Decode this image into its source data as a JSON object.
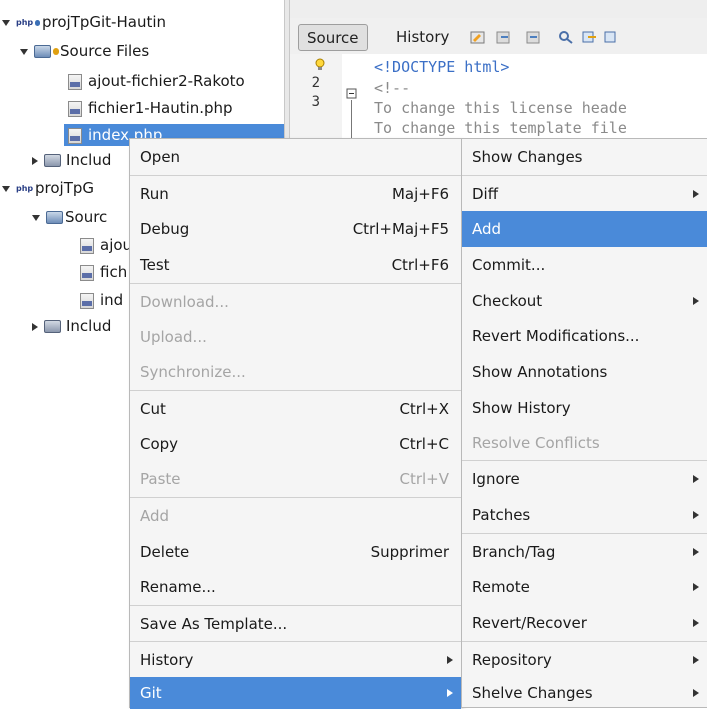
{
  "tree": {
    "project1": {
      "label": "projTpGit-Hautin"
    },
    "source_files1": {
      "label": "Source Files"
    },
    "files1": [
      "ajout-fichier2-Rakoto",
      "fichier1-Hautin.php",
      "index.php"
    ],
    "include1": {
      "label": "Includ"
    },
    "project2": {
      "label": "projTpG"
    },
    "source_files2": {
      "label": "Sourc"
    },
    "files2": [
      "ajou",
      "fich",
      "ind"
    ],
    "include2": {
      "label": "Includ"
    }
  },
  "editor": {
    "tabs": {
      "source": "Source",
      "history": "History"
    },
    "line_numbers": [
      "2",
      "3"
    ],
    "code": [
      "<!DOCTYPE html>",
      "<!--",
      "To change this license heade",
      "To change this template file"
    ]
  },
  "context_menu": {
    "items": [
      {
        "label": "Open",
        "shortcut": "",
        "disabled": false
      },
      {
        "label": "Run",
        "shortcut": "Maj+F6",
        "disabled": false
      },
      {
        "label": "Debug",
        "shortcut": "Ctrl+Maj+F5",
        "disabled": false
      },
      {
        "label": "Test",
        "shortcut": "Ctrl+F6",
        "disabled": false
      },
      {
        "label": "Download...",
        "shortcut": "",
        "disabled": true
      },
      {
        "label": "Upload...",
        "shortcut": "",
        "disabled": true
      },
      {
        "label": "Synchronize...",
        "shortcut": "",
        "disabled": true
      },
      {
        "label": "Cut",
        "shortcut": "Ctrl+X",
        "disabled": false
      },
      {
        "label": "Copy",
        "shortcut": "Ctrl+C",
        "disabled": false
      },
      {
        "label": "Paste",
        "shortcut": "Ctrl+V",
        "disabled": true
      },
      {
        "label": "Add",
        "shortcut": "",
        "disabled": true
      },
      {
        "label": "Delete",
        "shortcut": "Supprimer",
        "disabled": false
      },
      {
        "label": "Rename...",
        "shortcut": "",
        "disabled": false
      },
      {
        "label": "Save As Template...",
        "shortcut": "",
        "disabled": false
      },
      {
        "label": "History",
        "shortcut": "",
        "disabled": false
      },
      {
        "label": "Git",
        "shortcut": "",
        "disabled": false
      }
    ]
  },
  "git_submenu": {
    "items": [
      {
        "label": "Show Changes"
      },
      {
        "label": "Diff"
      },
      {
        "label": "Add"
      },
      {
        "label": "Commit..."
      },
      {
        "label": "Checkout"
      },
      {
        "label": "Revert Modifications..."
      },
      {
        "label": "Show Annotations"
      },
      {
        "label": "Show History"
      },
      {
        "label": "Resolve Conflicts"
      },
      {
        "label": "Ignore"
      },
      {
        "label": "Patches"
      },
      {
        "label": "Branch/Tag"
      },
      {
        "label": "Remote"
      },
      {
        "label": "Revert/Recover"
      },
      {
        "label": "Repository"
      },
      {
        "label": "Shelve Changes"
      }
    ]
  },
  "colors": {
    "selection": "#4a8ad9",
    "menu_bg": "#f5f5f5",
    "disabled_text": "#a5a5a5"
  }
}
